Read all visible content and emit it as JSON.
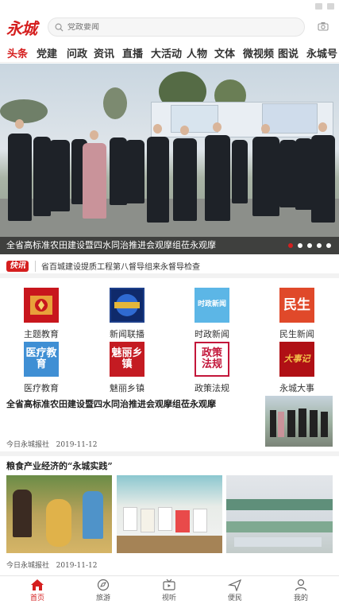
{
  "header": {
    "logo": "永城",
    "search_placeholder": "党政要闻"
  },
  "nav": {
    "items": [
      "头条",
      "党建",
      "问政",
      "资讯",
      "直播",
      "大活动",
      "人物",
      "文体",
      "微视频",
      "图说",
      "永城号"
    ],
    "active": "头条"
  },
  "banner": {
    "caption": "全省高标准农田建设暨四水同治推进会观摩组莅永观摩",
    "slide_count": 5,
    "active_slide": 1
  },
  "flash": {
    "badge": "快讯",
    "text": "省百城建设提质工程第八督导组来永督导检查"
  },
  "grid": [
    {
      "label": "主题教育",
      "icon": "theme-education-icon",
      "icon_text": "",
      "color": "#c8161d"
    },
    {
      "label": "新闻联播",
      "icon": "news-broadcast-icon",
      "icon_text": "",
      "color": "#1d3f8a"
    },
    {
      "label": "时政新闻",
      "icon": "politics-news-icon",
      "icon_text": "时政新闻",
      "color": "#5cb6e6"
    },
    {
      "label": "民生新闻",
      "icon": "livelihood-news-icon",
      "icon_text": "民生",
      "color": "#e0492a"
    },
    {
      "label": "医疗教育",
      "icon": "medical-education-icon",
      "icon_text": "医疗教育",
      "color": "#3f8fd4"
    },
    {
      "label": "魅丽乡镇",
      "icon": "charming-towns-icon",
      "icon_text": "魅丽乡镇",
      "color": "#c41b22"
    },
    {
      "label": "政策法规",
      "icon": "policy-regulation-icon",
      "icon_text": "政策法规",
      "color": "#c3163a"
    },
    {
      "label": "永城大事",
      "icon": "yongcheng-events-icon",
      "icon_text": "大事记",
      "color": "#b01015"
    }
  ],
  "article1": {
    "title": "全省高标准农田建设暨四水同治推进会观摩组莅永观摩",
    "source": "今日永城报社",
    "date": "2019-11-12"
  },
  "article2": {
    "title": "粮食产业经济的“永城实践”",
    "source": "今日永城报社",
    "date": "2019-11-12"
  },
  "tabbar": {
    "items": [
      {
        "label": "首页",
        "icon": "home-icon"
      },
      {
        "label": "旅游",
        "icon": "travel-icon"
      },
      {
        "label": "视听",
        "icon": "tv-icon"
      },
      {
        "label": "便民",
        "icon": "send-icon"
      },
      {
        "label": "我的",
        "icon": "user-icon"
      }
    ],
    "active": "首页"
  },
  "colors": {
    "accent": "#d51f1f"
  }
}
